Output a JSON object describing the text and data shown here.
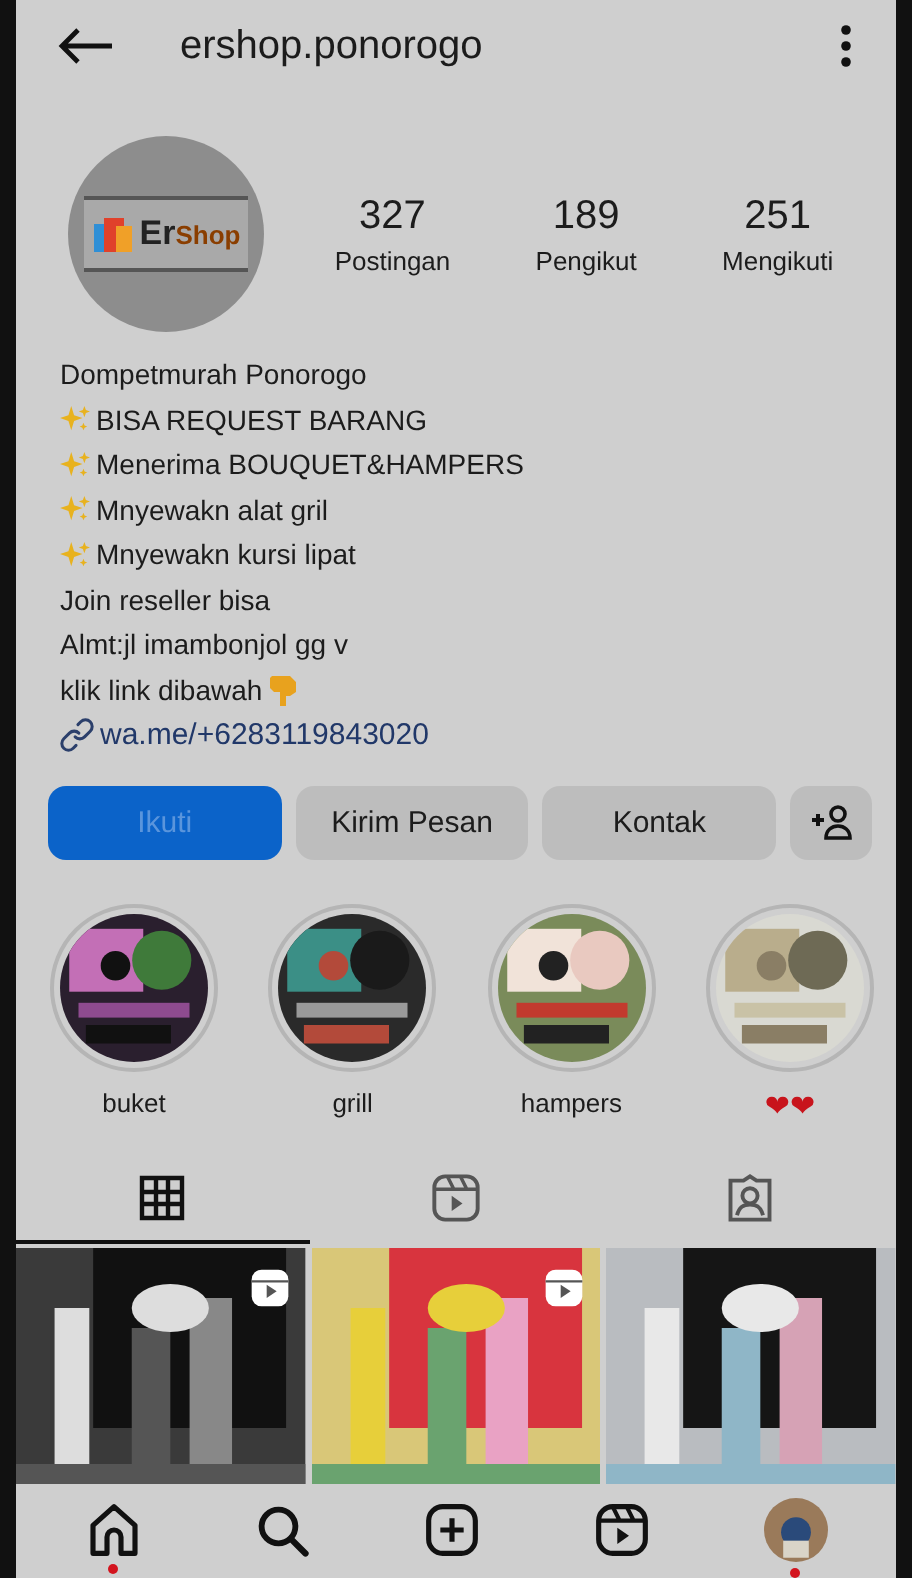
{
  "header": {
    "username": "ershop.ponorogo"
  },
  "profile": {
    "avatar_logo": "Er",
    "avatar_logo_accent": "Shop"
  },
  "stats": [
    {
      "value": "327",
      "label": "Postingan"
    },
    {
      "value": "189",
      "label": "Pengikut"
    },
    {
      "value": "251",
      "label": "Mengikuti"
    }
  ],
  "bio": [
    {
      "kind": "plain",
      "text": "Dompetmurah Ponorogo"
    },
    {
      "kind": "sparkle",
      "text": "BISA REQUEST BARANG"
    },
    {
      "kind": "sparkle",
      "text": "Menerima BOUQUET&HAMPERS"
    },
    {
      "kind": "sparkle",
      "text": "Mnyewakn alat gril"
    },
    {
      "kind": "sparkle",
      "text": "Mnyewakn kursi lipat"
    },
    {
      "kind": "plain",
      "text": "Join reseller bisa"
    },
    {
      "kind": "plain",
      "text": "Almt:jl imambonjol gg v"
    },
    {
      "kind": "point",
      "text": "klik link dibawah"
    },
    {
      "kind": "link",
      "text": "wa.me/+6283119843020"
    }
  ],
  "actions": [
    {
      "kind": "primary",
      "label": "Ikuti"
    },
    {
      "kind": "secondary",
      "label": "Kirim Pesan"
    },
    {
      "kind": "secondary",
      "label": "Kontak"
    },
    {
      "kind": "add-person"
    }
  ],
  "highlights": [
    {
      "label": "buket"
    },
    {
      "label": "grill"
    },
    {
      "label": "hampers"
    },
    {
      "label": "❤❤"
    }
  ],
  "tabs": [
    {
      "kind": "grid",
      "selected": true
    },
    {
      "kind": "reels",
      "selected": false
    },
    {
      "kind": "tagged",
      "selected": false
    }
  ],
  "posts": [
    {
      "reel": true
    },
    {
      "reel": true
    },
    {
      "reel": false
    }
  ],
  "nav": [
    {
      "kind": "home",
      "dot": true
    },
    {
      "kind": "search",
      "dot": false
    },
    {
      "kind": "create",
      "dot": false
    },
    {
      "kind": "reels",
      "dot": false
    },
    {
      "kind": "profile",
      "dot": true
    }
  ]
}
